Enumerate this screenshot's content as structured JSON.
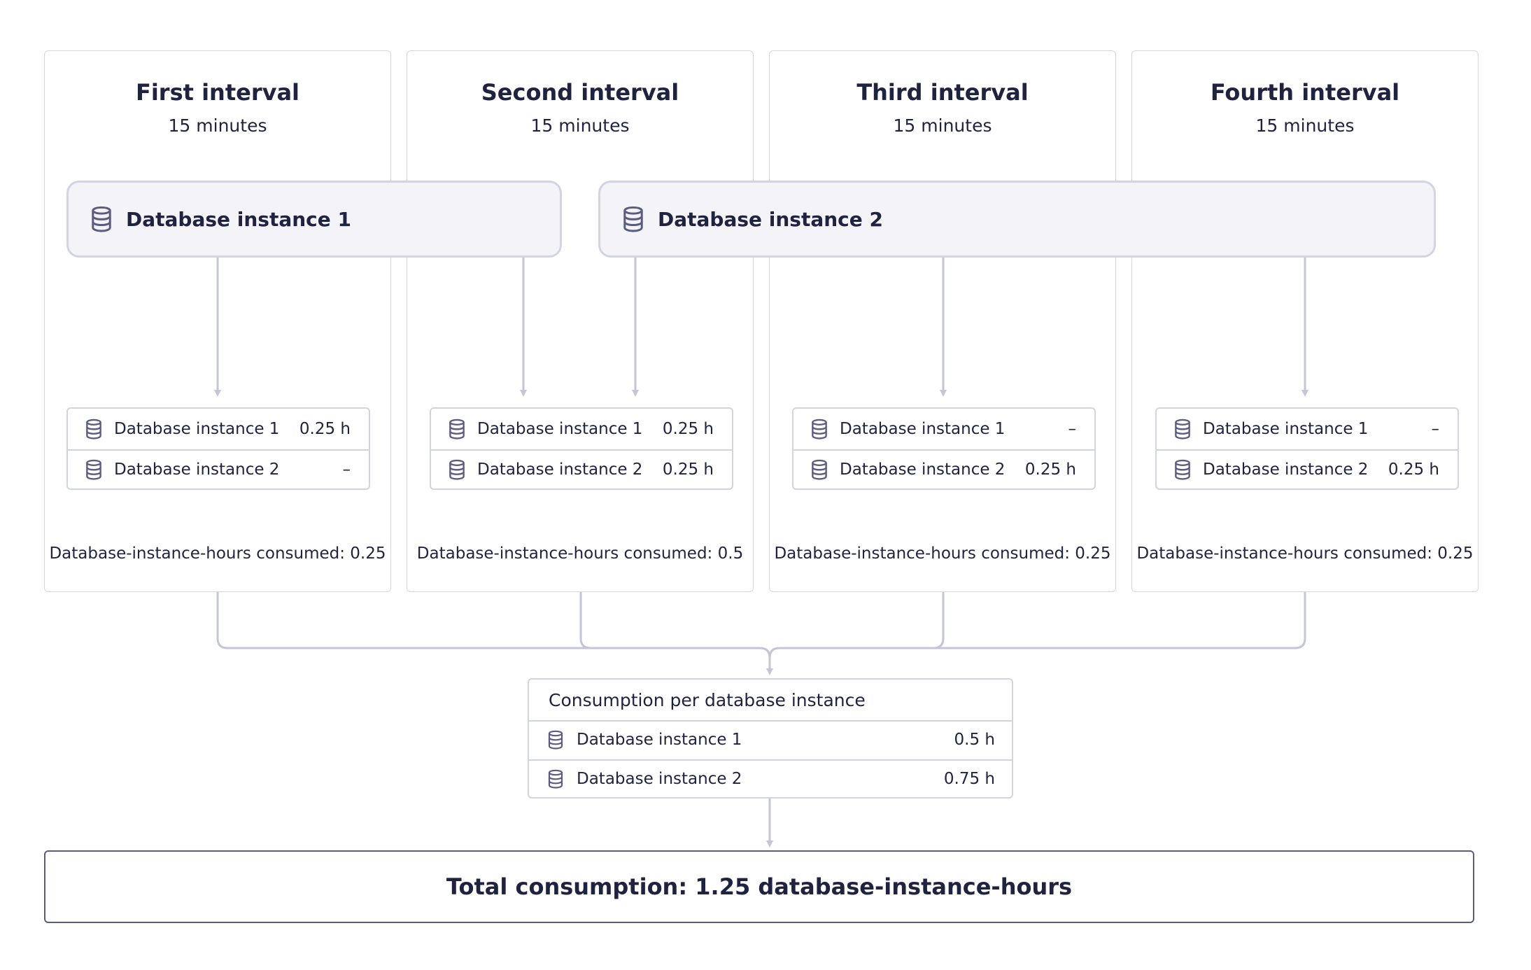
{
  "colors": {
    "text": "#1f2340",
    "border": "#d3d4e2",
    "bar_fill": "#f3f3f8",
    "connector": "#c4c5d6",
    "total_border": "#5a5c80"
  },
  "icons": {
    "database": "database-icon"
  },
  "intervals": [
    {
      "title": "First interval",
      "duration": "15 minutes",
      "rows": [
        {
          "name": "Database instance 1",
          "value": "0.25 h"
        },
        {
          "name": "Database instance 2",
          "value": "–"
        }
      ],
      "consumed": "Database-instance-hours consumed: 0.25"
    },
    {
      "title": "Second interval",
      "duration": "15 minutes",
      "rows": [
        {
          "name": "Database instance 1",
          "value": "0.25 h"
        },
        {
          "name": "Database instance 2",
          "value": "0.25 h"
        }
      ],
      "consumed": "Database-instance-hours consumed: 0.5"
    },
    {
      "title": "Third interval",
      "duration": "15 minutes",
      "rows": [
        {
          "name": "Database instance 1",
          "value": "–"
        },
        {
          "name": "Database instance 2",
          "value": "0.25 h"
        }
      ],
      "consumed": "Database-instance-hours consumed: 0.25"
    },
    {
      "title": "Fourth interval",
      "duration": "15 minutes",
      "rows": [
        {
          "name": "Database instance 1",
          "value": "–"
        },
        {
          "name": "Database instance 2",
          "value": "0.25 h"
        }
      ],
      "consumed": "Database-instance-hours consumed: 0.25"
    }
  ],
  "instances": [
    {
      "label": "Database instance 1"
    },
    {
      "label": "Database instance 2"
    }
  ],
  "summary": {
    "title": "Consumption per database instance",
    "rows": [
      {
        "name": "Database instance 1",
        "value": "0.5 h"
      },
      {
        "name": "Database instance 2",
        "value": "0.75 h"
      }
    ]
  },
  "total": "Total consumption: 1.25 database-instance-hours"
}
